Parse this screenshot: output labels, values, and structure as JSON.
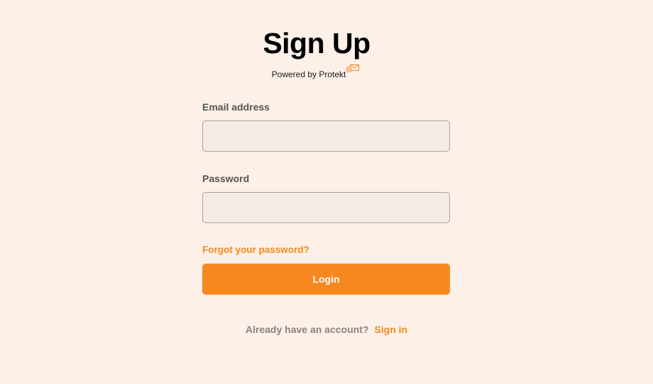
{
  "header": {
    "title": "Sign Up",
    "powered_by": "Powered by Protekt",
    "brand_icon": "envelope-badge-icon"
  },
  "form": {
    "email_label": "Email address",
    "email_value": "",
    "password_label": "Password",
    "password_value": "",
    "forgot_link": "Forgot your password?",
    "login_button": "Login"
  },
  "footer": {
    "question": "Already have an account?",
    "signin_link": "Sign in"
  },
  "colors": {
    "background": "#fdf0e8",
    "accent": "#f7881f",
    "input_background": "#f4ebe4",
    "label_text": "#555555",
    "muted_text": "#8a8380"
  }
}
